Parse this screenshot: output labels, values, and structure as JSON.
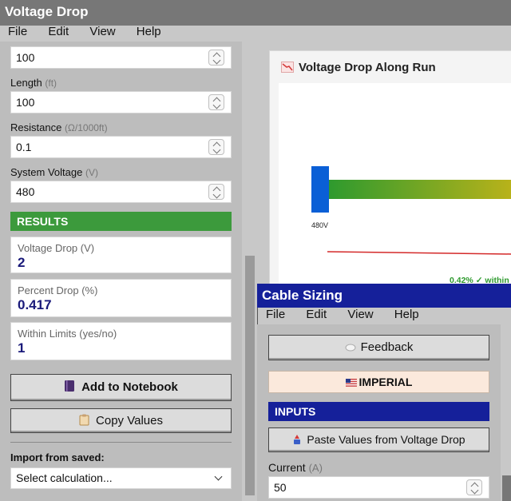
{
  "voltage_drop": {
    "title": "Voltage Drop",
    "menu": [
      "File",
      "Edit",
      "View",
      "Help"
    ],
    "top_field_value": "100",
    "length": {
      "label": "Length",
      "unit": "(ft)",
      "value": "100"
    },
    "resistance": {
      "label": "Resistance",
      "unit": "(Ω/1000ft)",
      "value": "0.1"
    },
    "system_voltage": {
      "label": "System Voltage",
      "unit": "(V)",
      "value": "480"
    },
    "results_header": "RESULTS",
    "results": [
      {
        "label": "Voltage Drop (V)",
        "value": "2"
      },
      {
        "label": "Percent Drop (%)",
        "value": "0.417"
      },
      {
        "label": "Within Limits (yes/no)",
        "value": "1"
      }
    ],
    "add_notebook_label": "Add to Notebook",
    "copy_values_label": "Copy Values",
    "import_label": "Import from saved:",
    "select_placeholder": "Select calculation..."
  },
  "chart": {
    "title": "Voltage Drop Along Run",
    "source_label": "480V",
    "status": "0.42% ✓ within",
    "colors": {
      "source": "#0a5fd6",
      "gradient_start": "#2e9a2e",
      "gradient_end": "#b8b21a",
      "limit_line": "#d42a2a",
      "status_text": "#2e9a2e"
    }
  },
  "chart_data": {
    "type": "bar",
    "title": "Voltage Drop Along Run",
    "categories": [
      "source"
    ],
    "values": [
      480
    ],
    "labels": [
      "480V"
    ],
    "annotations": [
      "0.42% ✓ within"
    ]
  },
  "cable_sizing": {
    "title": "Cable Sizing",
    "menu": [
      "File",
      "Edit",
      "View",
      "Help"
    ],
    "feedback_label": "Feedback",
    "imperial_label": "IMPERIAL",
    "inputs_header": "INPUTS",
    "paste_label": "Paste Values from Voltage Drop",
    "current": {
      "label": "Current",
      "unit": "(A)",
      "value": "50"
    }
  }
}
